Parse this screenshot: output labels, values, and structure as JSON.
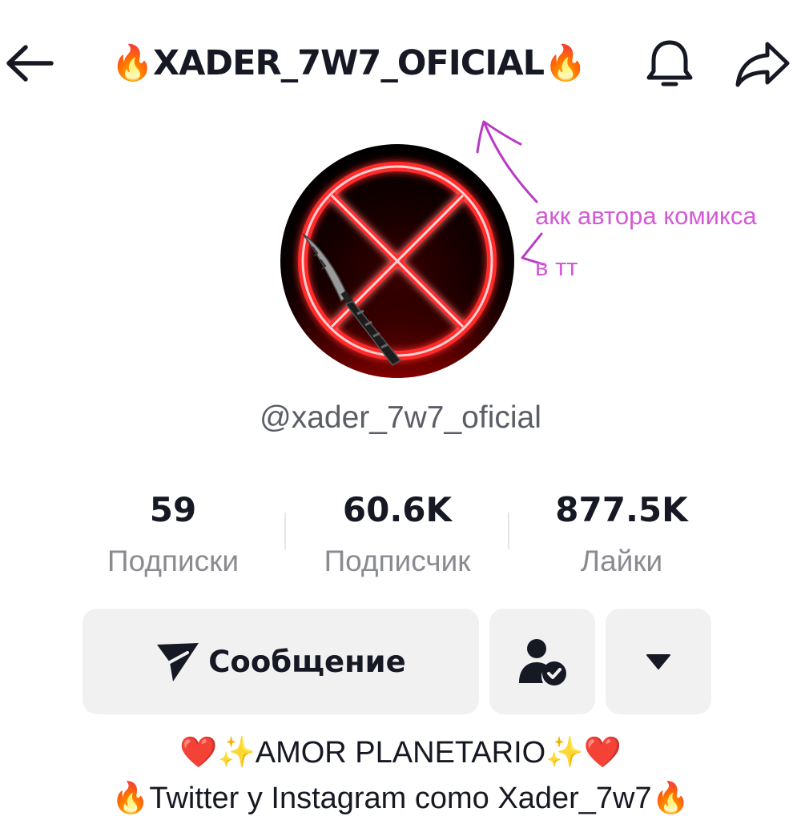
{
  "header": {
    "title": "🔥XADER_7W7_OFICIAL🔥",
    "back_icon": "arrow-left-icon",
    "bell_icon": "bell-icon",
    "share_icon": "share-arrow-icon"
  },
  "annotation": {
    "line1": "акк автора комикса",
    "line2": "в тт",
    "color": "#d35ad6"
  },
  "profile": {
    "username": "@xader_7w7_oficial"
  },
  "stats": {
    "following": {
      "value": "59",
      "label": "Подписки"
    },
    "followers": {
      "value": "60.6K",
      "label": "Подписчик"
    },
    "likes": {
      "value": "877.5K",
      "label": "Лайки"
    }
  },
  "actions": {
    "message_label": "Сообщение",
    "message_icon": "send-paper-plane-icon",
    "friend_icon": "user-check-icon",
    "more_icon": "caret-down-icon"
  },
  "bio": {
    "line1": "❤️✨AMOR PLANETARIO✨❤️",
    "line2": "🔥Twitter y Instagram como Xader_7w7🔥"
  },
  "colors": {
    "text_primary": "#161823",
    "text_secondary": "#8a8b91",
    "button_bg": "#f1f1f2",
    "avatar_red": "#ff3b3b"
  }
}
